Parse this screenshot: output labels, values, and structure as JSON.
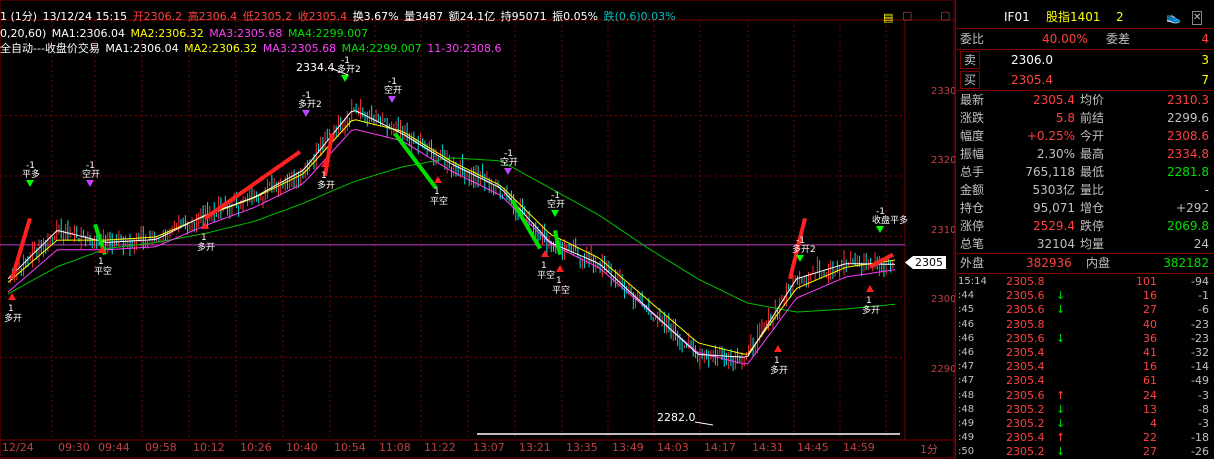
{
  "header": {
    "line1": {
      "period": "1 (1分)",
      "datetime": "13/12/24 15:15",
      "open": "开2306.2",
      "high": "高2306.4",
      "low": "低2305.2",
      "close": "收2305.4",
      "turnover_rate": "换3.67%",
      "volume": "量3487",
      "amount": "额24.1亿",
      "position": "持95071",
      "amplitude": "振0.05%",
      "change": "跌(0.6)0.03%"
    },
    "line2": {
      "prefix": "0,20,60)",
      "ma1": "MA1:2306.04",
      "ma2": "MA2:2306.32",
      "ma3": "MA3:2305.68",
      "ma4": "MA4:2299.007"
    },
    "line3": {
      "prefix": "全自动---收盘价交易",
      "ma1": "MA1:2306.04",
      "ma2": "MA2:2306.32",
      "ma3": "MA3:2305.68",
      "ma4": "MA4:2299.007",
      "extra": "11-30:2308.6"
    }
  },
  "chart_labels": {
    "high_mark": "2334.4",
    "low_mark": "2282.0",
    "current_price_tag": "2305",
    "period_label": "1分",
    "y_ticks": [
      "2330",
      "2320",
      "2310",
      "2300",
      "2290"
    ],
    "x_ticks": [
      "12/24",
      "09:30",
      "09:44",
      "09:58",
      "10:12",
      "10:26",
      "10:40",
      "10:54",
      "11:08",
      "11:22",
      "13:07",
      "13:21",
      "13:35",
      "13:49",
      "14:03",
      "14:17",
      "14:31",
      "14:45",
      "14:59"
    ]
  },
  "signals": [
    {
      "label": "-1",
      "text": "平多",
      "kind": "short"
    },
    {
      "label": "-1",
      "text": "空开",
      "kind": "short"
    },
    {
      "label": "1",
      "text": "平空",
      "kind": "long"
    },
    {
      "label": "1",
      "text": "多开",
      "kind": "long"
    },
    {
      "label": "-1",
      "text": "多开2",
      "kind": "short"
    },
    {
      "label": "1",
      "text": "多开",
      "kind": "long"
    },
    {
      "label": "-1",
      "text": "多开2",
      "kind": "short"
    },
    {
      "label": "-1",
      "text": "空开",
      "kind": "short"
    },
    {
      "label": "1",
      "text": "平空",
      "kind": "long"
    },
    {
      "label": "-1",
      "text": "空开",
      "kind": "short"
    },
    {
      "label": "-1",
      "text": "空开",
      "kind": "short"
    },
    {
      "label": "1",
      "text": "平空",
      "kind": "long"
    },
    {
      "label": "1",
      "text": "平空",
      "kind": "long"
    },
    {
      "label": "-1",
      "text": "多开2",
      "kind": "short"
    },
    {
      "label": "1",
      "text": "多开",
      "kind": "long"
    },
    {
      "label": "1",
      "text": "多开",
      "kind": "long"
    },
    {
      "label": "-1",
      "text": "收盘平多",
      "kind": "short"
    },
    {
      "label": "1",
      "text": "多开",
      "kind": "long"
    }
  ],
  "chart_data": {
    "type": "candlestick",
    "y_range": [
      2278,
      2340
    ],
    "x_categories": [
      "12/24",
      "09:30",
      "09:44",
      "09:58",
      "10:12",
      "10:26",
      "10:40",
      "10:54",
      "11:08",
      "11:22",
      "13:07",
      "13:21",
      "13:35",
      "13:49",
      "14:03",
      "14:17",
      "14:31",
      "14:45",
      "14:59"
    ],
    "close_series": [
      2303.0,
      2311.0,
      2309.0,
      2309.5,
      2313.5,
      2316.5,
      2321.0,
      2331.0,
      2327.0,
      2322.0,
      2318.0,
      2309.0,
      2305.5,
      2298.0,
      2290.5,
      2290.0,
      2303.0,
      2305.5,
      2305.4
    ],
    "ma_long_series": [
      2300.5,
      2305.0,
      2308.0,
      2309.0,
      2310.5,
      2312.5,
      2315.5,
      2319.0,
      2321.5,
      2323.0,
      2322.5,
      2318.0,
      2313.5,
      2308.0,
      2303.0,
      2299.0,
      2297.5,
      2298.0,
      2298.8
    ],
    "ma_mid_series": [
      2302.0,
      2309.0,
      2309.0,
      2309.5,
      2313.0,
      2316.0,
      2320.0,
      2329.0,
      2327.0,
      2322.0,
      2318.0,
      2310.0,
      2306.0,
      2299.0,
      2292.0,
      2290.0,
      2301.0,
      2304.5,
      2305.7
    ],
    "reference_line": 2308.6,
    "high": 2334.4,
    "low": 2282.0
  },
  "right_panel": {
    "title": {
      "code": "IF01",
      "name": "股指1401",
      "num": "2"
    },
    "weibi": {
      "label": "委比",
      "value": "40.00%",
      "label2": "委差",
      "value2": "4"
    },
    "sell": {
      "label": "卖",
      "price": "2306.0",
      "qty": "3"
    },
    "buy": {
      "label": "买",
      "price": "2305.4",
      "qty": "7"
    },
    "stats": [
      {
        "l1": "最新",
        "v1": "2305.4",
        "c1": "#ff4040",
        "l2": "均价",
        "v2": "2310.3",
        "c2": "#ff4040"
      },
      {
        "l1": "涨跌",
        "v1": "5.8",
        "c1": "#ff4040",
        "l2": "前结",
        "v2": "2299.6",
        "c2": "#c0c0c0"
      },
      {
        "l1": "幅度",
        "v1": "+0.25%",
        "c1": "#ff4040",
        "l2": "今开",
        "v2": "2308.6",
        "c2": "#ff4040"
      },
      {
        "l1": "振幅",
        "v1": "2.30%",
        "c1": "#c0c0c0",
        "l2": "最高",
        "v2": "2334.8",
        "c2": "#ff4040"
      },
      {
        "l1": "总手",
        "v1": "765,118",
        "c1": "#c0c0c0",
        "l2": "最低",
        "v2": "2281.8",
        "c2": "#00e000"
      },
      {
        "l1": "金额",
        "v1": "5303亿",
        "c1": "#c0c0c0",
        "l2": "量比",
        "v2": "-",
        "c2": "#c0c0c0"
      },
      {
        "l1": "持仓",
        "v1": "95,071",
        "c1": "#c0c0c0",
        "l2": "增仓",
        "v2": "+292",
        "c2": "#c0c0c0"
      },
      {
        "l1": "涨停",
        "v1": "2529.4",
        "c1": "#ff4040",
        "l2": "跌停",
        "v2": "2069.8",
        "c2": "#00e000"
      },
      {
        "l1": "总笔",
        "v1": "32104",
        "c1": "#c0c0c0",
        "l2": "均量",
        "v2": "24",
        "c2": "#c0c0c0"
      }
    ],
    "outer": {
      "label": "外盘",
      "value": "382936",
      "label2": "内盘",
      "value2": "382182"
    },
    "ticks": [
      {
        "time": "15:14",
        "price": "2305.8",
        "arrow": "",
        "vol": "101",
        "chg": "-94",
        "pc": "#ff4040"
      },
      {
        "time": ":44",
        "price": "2305.6",
        "arrow": "↓",
        "vol": "16",
        "chg": "-1",
        "pc": "#ff4040"
      },
      {
        "time": ":45",
        "price": "2305.6",
        "arrow": "↓",
        "vol": "27",
        "chg": "-6",
        "pc": "#ff4040"
      },
      {
        "time": ":46",
        "price": "2305.8",
        "arrow": "",
        "vol": "40",
        "chg": "-23",
        "pc": "#ff4040"
      },
      {
        "time": ":46",
        "price": "2305.6",
        "arrow": "↓",
        "vol": "36",
        "chg": "-23",
        "pc": "#ff4040"
      },
      {
        "time": ":46",
        "price": "2305.4",
        "arrow": "",
        "vol": "41",
        "chg": "-32",
        "pc": "#ff4040"
      },
      {
        "time": ":47",
        "price": "2305.4",
        "arrow": "",
        "vol": "16",
        "chg": "-14",
        "pc": "#ff4040"
      },
      {
        "time": ":47",
        "price": "2305.4",
        "arrow": "",
        "vol": "61",
        "chg": "-49",
        "pc": "#ff4040"
      },
      {
        "time": ":48",
        "price": "2305.6",
        "arrow": "↑",
        "vol": "24",
        "chg": "-3",
        "pc": "#ff4040"
      },
      {
        "time": ":48",
        "price": "2305.2",
        "arrow": "↓",
        "vol": "13",
        "chg": "-8",
        "pc": "#ff4040"
      },
      {
        "time": ":49",
        "price": "2305.2",
        "arrow": "↓",
        "vol": "4",
        "chg": "-3",
        "pc": "#ff4040"
      },
      {
        "time": ":49",
        "price": "2305.4",
        "arrow": "↑",
        "vol": "22",
        "chg": "-18",
        "pc": "#ff4040"
      },
      {
        "time": ":50",
        "price": "2305.2",
        "arrow": "↓",
        "vol": "27",
        "chg": "-26",
        "pc": "#ff4040"
      }
    ]
  },
  "colors": {
    "up": "#ff3030",
    "down": "#00e0e0",
    "ma_fast": "#ffffff",
    "ma_mid": "#ffff00",
    "ma_slow": "#ff40ff",
    "ma_long": "#00c000",
    "grid": "#800000"
  }
}
